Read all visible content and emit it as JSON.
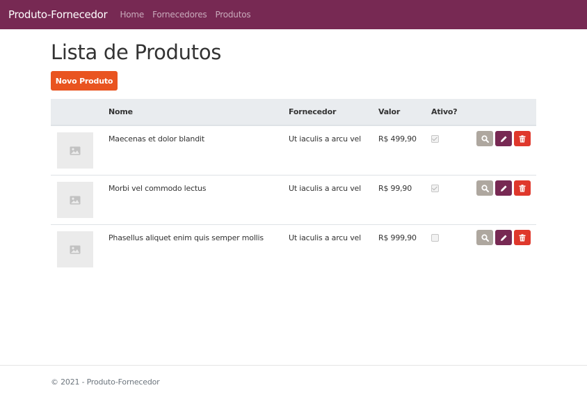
{
  "navbar": {
    "brand": "Produto-Fornecedor",
    "links": [
      "Home",
      "Fornecedores",
      "Produtos"
    ],
    "background_color": "#772953"
  },
  "page": {
    "title": "Lista de Produtos",
    "new_button_label": "Novo Produto",
    "accent_color": "#e95420"
  },
  "table": {
    "headers": [
      "",
      "Nome",
      "Fornecedor",
      "Valor",
      "Ativo?",
      ""
    ],
    "rows": [
      {
        "nome": "Maecenas et dolor blandit",
        "fornecedor": "Ut iaculis a arcu vel",
        "valor": "R$ 499,90",
        "ativo": true
      },
      {
        "nome": "Morbi vel commodo lectus",
        "fornecedor": "Ut iaculis a arcu vel",
        "valor": "R$ 99,90",
        "ativo": true
      },
      {
        "nome": "Phasellus aliquet enim quis semper mollis",
        "fornecedor": "Ut iaculis a arcu vel",
        "valor": "R$ 999,90",
        "ativo": false
      }
    ],
    "row_icon": "image-placeholder-icon",
    "action_icons": [
      "search-icon",
      "pencil-icon",
      "trash-icon"
    ],
    "action_colors": [
      "#aea79f",
      "#772953",
      "#df382c"
    ]
  },
  "footer": {
    "text": "© 2021 - Produto-Fornecedor"
  }
}
